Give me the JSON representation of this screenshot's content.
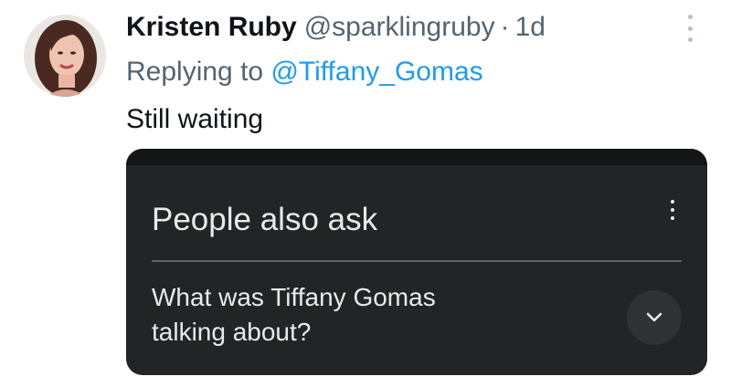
{
  "tweet": {
    "author_name": "Kristen Ruby",
    "author_handle": "@sparklingruby",
    "separator": "·",
    "time_ago": "1d",
    "replying_prefix": "Replying to",
    "replying_to": "@Tiffany_Gomas",
    "text": "Still waiting"
  },
  "card": {
    "title": "People also ask",
    "question_line1": "What was Tiffany Gomas",
    "question_line2": "talking about?"
  },
  "icons": {
    "tweet_more": "more-vertical-icon",
    "card_more": "more-vertical-icon",
    "expand": "chevron-down-icon"
  },
  "colors": {
    "name": "#0f1419",
    "secondary": "#536471",
    "link": "#1d9bf0",
    "card_bg": "#232426",
    "card_text": "#e8eaed"
  }
}
